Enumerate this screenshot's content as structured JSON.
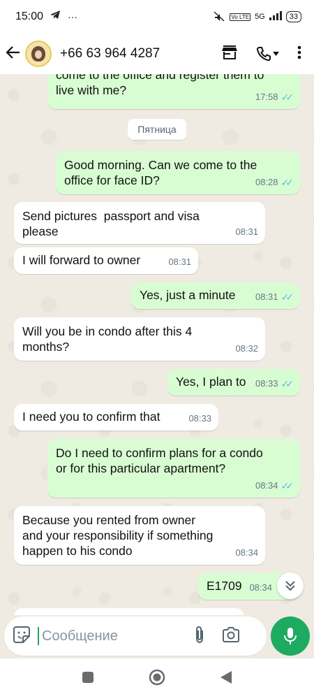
{
  "status_bar": {
    "time": "15:00",
    "network": "5G",
    "battery": "33"
  },
  "header": {
    "contact_name": "+66 63 964 4287"
  },
  "chat": {
    "day_label": "Пятница",
    "messages": [
      {
        "direction": "out",
        "text": "come to the office and register them to\nlive with me?",
        "time": "17:58",
        "read": true
      },
      {
        "direction": "out",
        "text": "Good morning. Can we come to the\noffice for face ID?",
        "time": "08:28",
        "read": true
      },
      {
        "direction": "in",
        "text": "Send pictures  passport and visa\nplease",
        "time": "08:31"
      },
      {
        "direction": "in",
        "text": "I will forward to owner",
        "time": "08:31"
      },
      {
        "direction": "out",
        "text": "Yes, just a minute",
        "time": "08:31",
        "read": true
      },
      {
        "direction": "in",
        "text": "Will you be in condo after this 4\nmonths?",
        "time": "08:32"
      },
      {
        "direction": "out",
        "text": "Yes, I plan to",
        "time": "08:33",
        "read": true
      },
      {
        "direction": "in",
        "text": "I need you to confirm that",
        "time": "08:33"
      },
      {
        "direction": "out",
        "text": "Do I need to confirm plans for a condo\nor for this particular apartment?",
        "time": "08:34",
        "read": true
      },
      {
        "direction": "in",
        "text": "Because you rented from owner\nand your responsibility if something\nhappen to his condo",
        "time": "08:34"
      },
      {
        "direction": "out",
        "text": "E1709",
        "time": "08:34",
        "read": false
      }
    ]
  },
  "composer": {
    "placeholder": "Сообщение"
  },
  "colors": {
    "accent": "#1daa61",
    "outgoing_bubble": "#d9fdd3",
    "chat_background": "#efeae2",
    "read_ticks": "#53bdeb"
  }
}
